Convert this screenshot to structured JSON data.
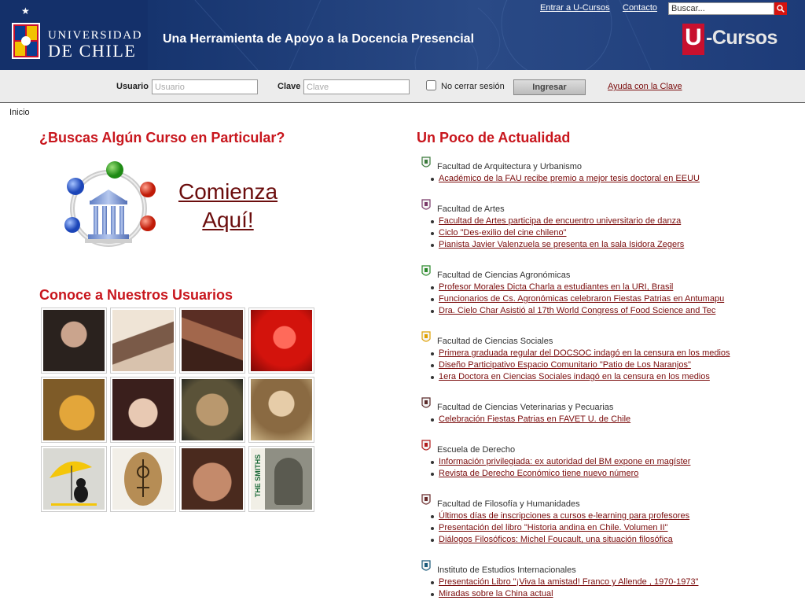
{
  "header": {
    "university_line1": "UNIVERSIDAD",
    "university_line2": "DE CHILE",
    "tagline": "Una Herramienta de Apoyo a la Docencia Presencial",
    "links": {
      "entrar": "Entrar a U-Cursos",
      "contacto": "Contacto"
    },
    "search_placeholder": "Buscar...",
    "logo_u": "U",
    "logo_rest": "-Cursos"
  },
  "login": {
    "user_label": "Usuario",
    "user_placeholder": "Usuario",
    "pass_label": "Clave",
    "pass_placeholder": "Clave",
    "remember_label": "No cerrar sesión",
    "button_label": "Ingresar",
    "help_link": "Ayuda con la Clave"
  },
  "breadcrumb": "Inicio",
  "left": {
    "search_heading": "¿Buscas Algún Curso en Particular?",
    "cta_line1": "Comienza",
    "cta_line2": "Aquí!",
    "users_heading": "Conoce a Nuestros Usuarios",
    "users": [
      {
        "name": "user-photo-1"
      },
      {
        "name": "user-photo-2"
      },
      {
        "name": "user-photo-3"
      },
      {
        "name": "user-photo-4"
      },
      {
        "name": "user-photo-5"
      },
      {
        "name": "user-photo-6"
      },
      {
        "name": "user-photo-7"
      },
      {
        "name": "user-photo-8"
      },
      {
        "name": "user-photo-9"
      },
      {
        "name": "user-photo-10"
      },
      {
        "name": "user-photo-11"
      },
      {
        "name": "user-photo-12"
      }
    ],
    "smiths_text": "THE SMITHS"
  },
  "right": {
    "heading": "Un Poco de Actualidad",
    "groups": [
      {
        "faculty": "Facultad de Arquitectura y Urbanismo",
        "icon": "building-crest-icon",
        "items": [
          "Académico de la FAU recibe premio a mejor tesis doctoral en EEUU"
        ]
      },
      {
        "faculty": "Facultad de Artes",
        "icon": "crest-icon",
        "items": [
          "Facultad de Artes participa de encuentro universitario de danza",
          "Ciclo \"Des-exilio del cine chileno\"",
          "Pianista Javier Valenzuela se presenta en la sala Isidora Zegers"
        ]
      },
      {
        "faculty": "Facultad de Ciencias Agronómicas",
        "icon": "agro-icon",
        "items": [
          "Profesor Morales Dicta Charla a estudiantes en la URI, Brasil",
          "Funcionarios de Cs. Agronómicas celebraron Fiestas Patrias en Antumapu",
          "Dra. Cielo Char Asistió al 17th World Congress of Food Science and Tec"
        ]
      },
      {
        "faculty": "Facultad de Ciencias Sociales",
        "icon": "cs-icon",
        "items": [
          "Primera graduada regular del DOCSOC indagó en la censura en los medios",
          "Diseño Participativo Espacio Comunitario \"Patio de Los Naranjos\"",
          "1era Doctora en Ciencias Sociales indagó en la censura en los medios"
        ]
      },
      {
        "faculty": "Facultad de Ciencias Veterinarias y Pecuarias",
        "icon": "vet-icon",
        "items": [
          "Celebración Fiestas Patrias en FAVET U. de Chile"
        ]
      },
      {
        "faculty": "Escuela de Derecho",
        "icon": "law-crest-icon",
        "items": [
          "Información privilegiada: ex autoridad del BM expone en magíster",
          "Revista de Derecho Económico tiene nuevo número"
        ]
      },
      {
        "faculty": "Facultad de Filosofía y Humanidades",
        "icon": "philosophy-icon",
        "items": [
          "Últimos días de inscripciones a cursos e-learning para profesores",
          "Presentación del libro \"Historia andina en Chile. Volumen II\"",
          "Diálogos Filosóficos: Michel Foucault, una situación filosófica"
        ]
      },
      {
        "faculty": "Instituto de Estudios Internacionales",
        "icon": "globe-icon",
        "items": [
          "Presentación Libro \"¡Viva la amistad! Franco y Allende , 1970-1973\"",
          "Miradas sobre la China actual"
        ]
      }
    ]
  },
  "colors": {
    "header_bg": "#1f3a72",
    "heading_red": "#c8161d",
    "link_dark_red": "#7a0b0b",
    "login_bar_bg": "#ececec",
    "brand_red": "#c8102e"
  }
}
